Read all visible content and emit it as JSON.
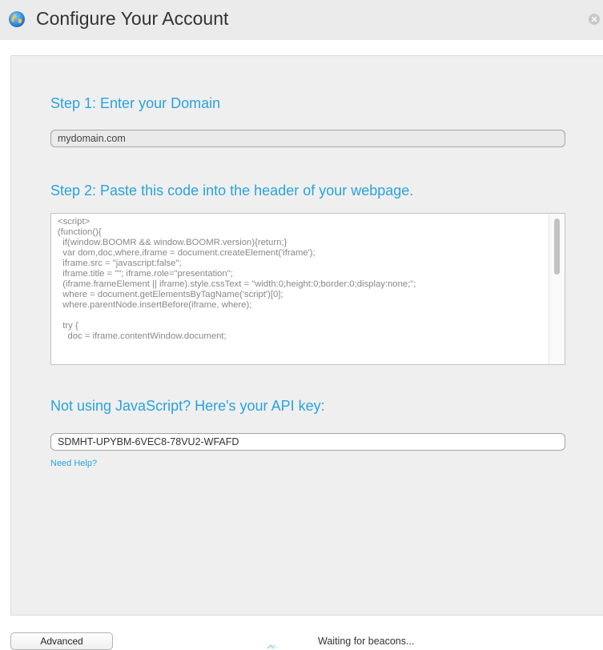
{
  "window": {
    "title": "Configure Your Account",
    "icon": "globe-icon",
    "close_icon": "close-icon"
  },
  "step1": {
    "heading": "Step 1: Enter your Domain",
    "domain_value": "mydomain.com"
  },
  "step2": {
    "heading": "Step 2: Paste this code into the header of your webpage.",
    "code": "<script>\n(function(){\n  if(window.BOOMR && window.BOOMR.version){return;}\n  var dom,doc,where,iframe = document.createElement('iframe');\n  iframe.src = \"javascript:false\";\n  iframe.title = \"\"; iframe.role=\"presentation\";\n  (iframe.frameElement || iframe).style.cssText = \"width:0;height:0;border:0;display:none;\";\n  where = document.getElementsByTagName('script')[0];\n  where.parentNode.insertBefore(iframe, where);\n\n  try {\n    doc = iframe.contentWindow.document;"
  },
  "api": {
    "heading": "Not using JavaScript? Here's your API key:",
    "key_value": "SDMHT-UPYBM-6VEC8-78VU2-WFAFD",
    "help_link": "Need Help?"
  },
  "footer": {
    "advanced_label": "Advanced",
    "status_text": "Waiting for beacons...",
    "status_icon": "spinner-icon"
  },
  "colors": {
    "accent": "#2aa3dc",
    "titlebar_bg": "#ebebeb",
    "panel_bg": "#efefef"
  }
}
